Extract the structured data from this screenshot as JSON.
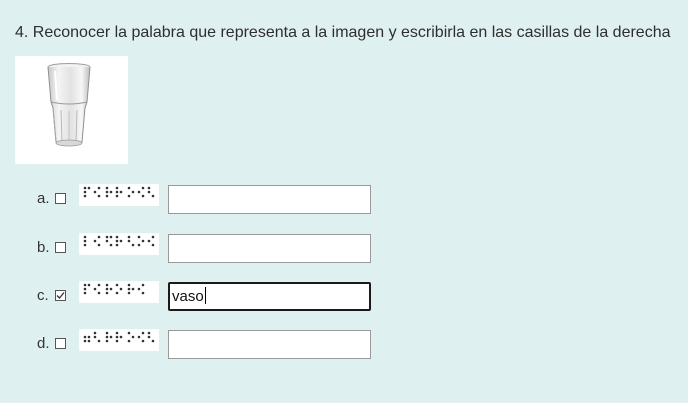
{
  "question": {
    "text": "4. Reconocer la palabra que representa a la imagen y escribirla en las casillas de la derecha"
  },
  "image": {
    "icon": "glass-icon"
  },
  "options": [
    {
      "letter": "a.",
      "checked": false,
      "answer_value": "",
      "answer_placeholder": ""
    },
    {
      "letter": "b.",
      "checked": false,
      "answer_value": "",
      "answer_placeholder": ""
    },
    {
      "letter": "c.",
      "checked": true,
      "answer_value": "vaso",
      "answer_placeholder": ""
    },
    {
      "letter": "d.",
      "checked": false,
      "answer_value": "",
      "answer_placeholder": ""
    }
  ]
}
